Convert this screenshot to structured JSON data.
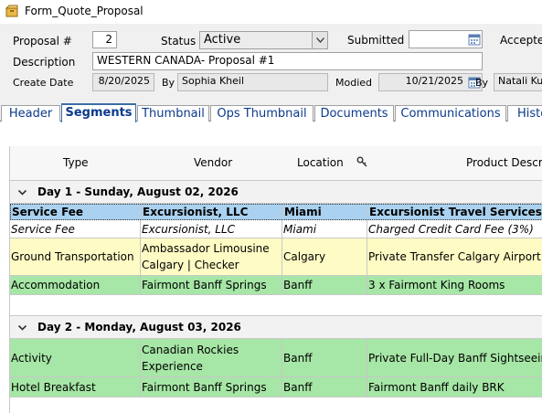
{
  "window": {
    "title": "Form_Quote_Proposal",
    "icon": "form-box-icon"
  },
  "form": {
    "proposal_label": "Proposal #",
    "proposal_value": "2",
    "status_label": "Status",
    "status_value": "Active",
    "submitted_label": "Submitted",
    "submitted_value": "",
    "accepted_label": "Accepte",
    "description_label": "Description",
    "description_value": "WESTERN CANADA- Proposal #1",
    "create_date_label": "Create Date",
    "create_date_value": "8/20/2025",
    "by_label_1": "By",
    "by_value_1": "Sophia Kheil",
    "modified_label": "Modied",
    "modified_value": "10/21/2025",
    "by_label_2": "By",
    "by_value_2": "Natali Kup"
  },
  "tabs": [
    {
      "label": "Header"
    },
    {
      "label": "Segments",
      "active": true
    },
    {
      "label": "Thumbnail"
    },
    {
      "label": "Ops Thumbnail"
    },
    {
      "label": "Documents"
    },
    {
      "label": "Communications"
    },
    {
      "label": "Histo"
    }
  ],
  "grid": {
    "columns": [
      "Type",
      "Vendor",
      "Location",
      "Product Descri"
    ],
    "days": [
      {
        "label": "Day 1 - Sunday, August 02, 2026",
        "rows": [
          {
            "type": "Service Fee",
            "vendor": "Excursionist, LLC",
            "location": "Miami",
            "product": "Excursionist Travel Services Fe",
            "style": "selected"
          },
          {
            "type": "Service Fee",
            "vendor": "Excursionist, LLC",
            "location": "Miami",
            "product": "Charged Credit Card Fee (3%)",
            "style": "italic"
          },
          {
            "type": "Ground Transportation",
            "vendor": "Ambassador Limousine Calgary | Checker",
            "location": "Calgary",
            "product": "Private Transfer Calgary Airport",
            "style": "yellow"
          },
          {
            "type": "Accommodation",
            "vendor": "Fairmont Banff Springs",
            "location": "Banff",
            "product": "3 x Fairmont King Rooms",
            "style": "green"
          }
        ]
      },
      {
        "label": "Day 2 - Monday, August 03, 2026",
        "rows": [
          {
            "type": "Activity",
            "vendor": "Canadian Rockies Experience",
            "location": "Banff",
            "product": "Private Full-Day Banff Sightseein",
            "style": "green"
          },
          {
            "type": "Hotel Breakfast",
            "vendor": "Fairmont Banff Springs",
            "location": "Banff",
            "product": "Fairmont Banff daily BRK",
            "style": "green"
          }
        ]
      }
    ]
  },
  "colors": {
    "selected_row": "#aad2f0",
    "yellow_row": "#fffbc4",
    "green_row": "#a6e6a6",
    "tab_text": "#0b3a8a",
    "accent": "#3a6ea5"
  }
}
